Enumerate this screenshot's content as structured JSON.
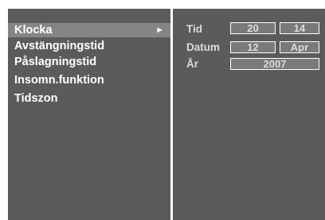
{
  "menu": {
    "items": [
      {
        "label": "Klocka",
        "selected": true
      },
      {
        "label": "Avstängningstid"
      },
      {
        "label": "Påslagningstid"
      },
      {
        "label": "Insomn.funktion"
      },
      {
        "label": "Tidszon"
      }
    ],
    "arrow_glyph": "►"
  },
  "clock": {
    "tid": {
      "label": "Tid",
      "hour": "20",
      "minute": "14"
    },
    "datum": {
      "label": "Datum",
      "day": "12",
      "month": "Apr"
    },
    "ar": {
      "label": "År",
      "year": "2007"
    }
  },
  "colors": {
    "panel": "#5b5b5b",
    "selected": "#858585",
    "field": "#7a7a7a",
    "text": "#ffffff",
    "label_text": "#dcdcdc"
  }
}
